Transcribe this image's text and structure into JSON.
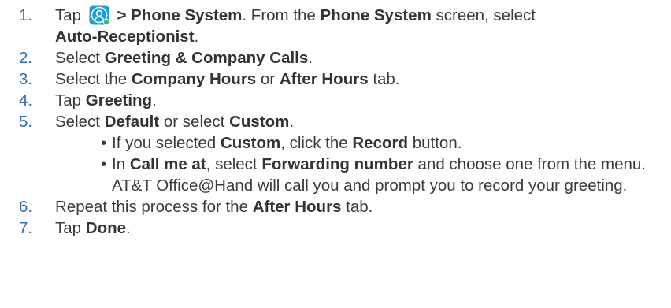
{
  "steps": [
    {
      "number": "1.",
      "text_a": "Tap",
      "bold_a": "> Phone System",
      "text_b": ". From the",
      "bold_b": "Phone System",
      "text_c": "screen, select",
      "bold_c": "Auto-Receptionist",
      "text_d": "."
    },
    {
      "number": "2.",
      "text_a": "Select",
      "bold_a": "Greeting & Company Calls",
      "text_b": "."
    },
    {
      "number": "3.",
      "text_a": "Select the",
      "bold_a": "Company Hours",
      "text_b": "or",
      "bold_b": "After Hours",
      "text_c": "tab."
    },
    {
      "number": "4.",
      "text_a": "Tap",
      "bold_a": "Greeting",
      "text_b": "."
    },
    {
      "number": "5.",
      "text_a": "Select",
      "bold_a": "Default",
      "text_b": "or select",
      "bold_b": "Custom",
      "text_c": ".",
      "sub": [
        {
          "bullet": "•",
          "text_a": "If you selected",
          "bold_a": "Custom",
          "text_b": ", click the",
          "bold_b": "Record",
          "text_c": "button."
        },
        {
          "bullet": "•",
          "text_a": "In",
          "bold_a": "Call me at",
          "text_b": ", select",
          "bold_b": "Forwarding number",
          "text_c": "and choose one from the menu. AT&T Office@Hand will call you and prompt you to record your greeting."
        }
      ]
    },
    {
      "number": "6.",
      "text_a": "Repeat this process for the",
      "bold_a": "After Hours",
      "text_b": "tab."
    },
    {
      "number": "7.",
      "text_a": "Tap",
      "bold_a": "Done",
      "text_b": "."
    }
  ],
  "icon": {
    "name": "user-avatar-icon",
    "color": "#1a9fd8",
    "badge_color": "#4cb848"
  }
}
